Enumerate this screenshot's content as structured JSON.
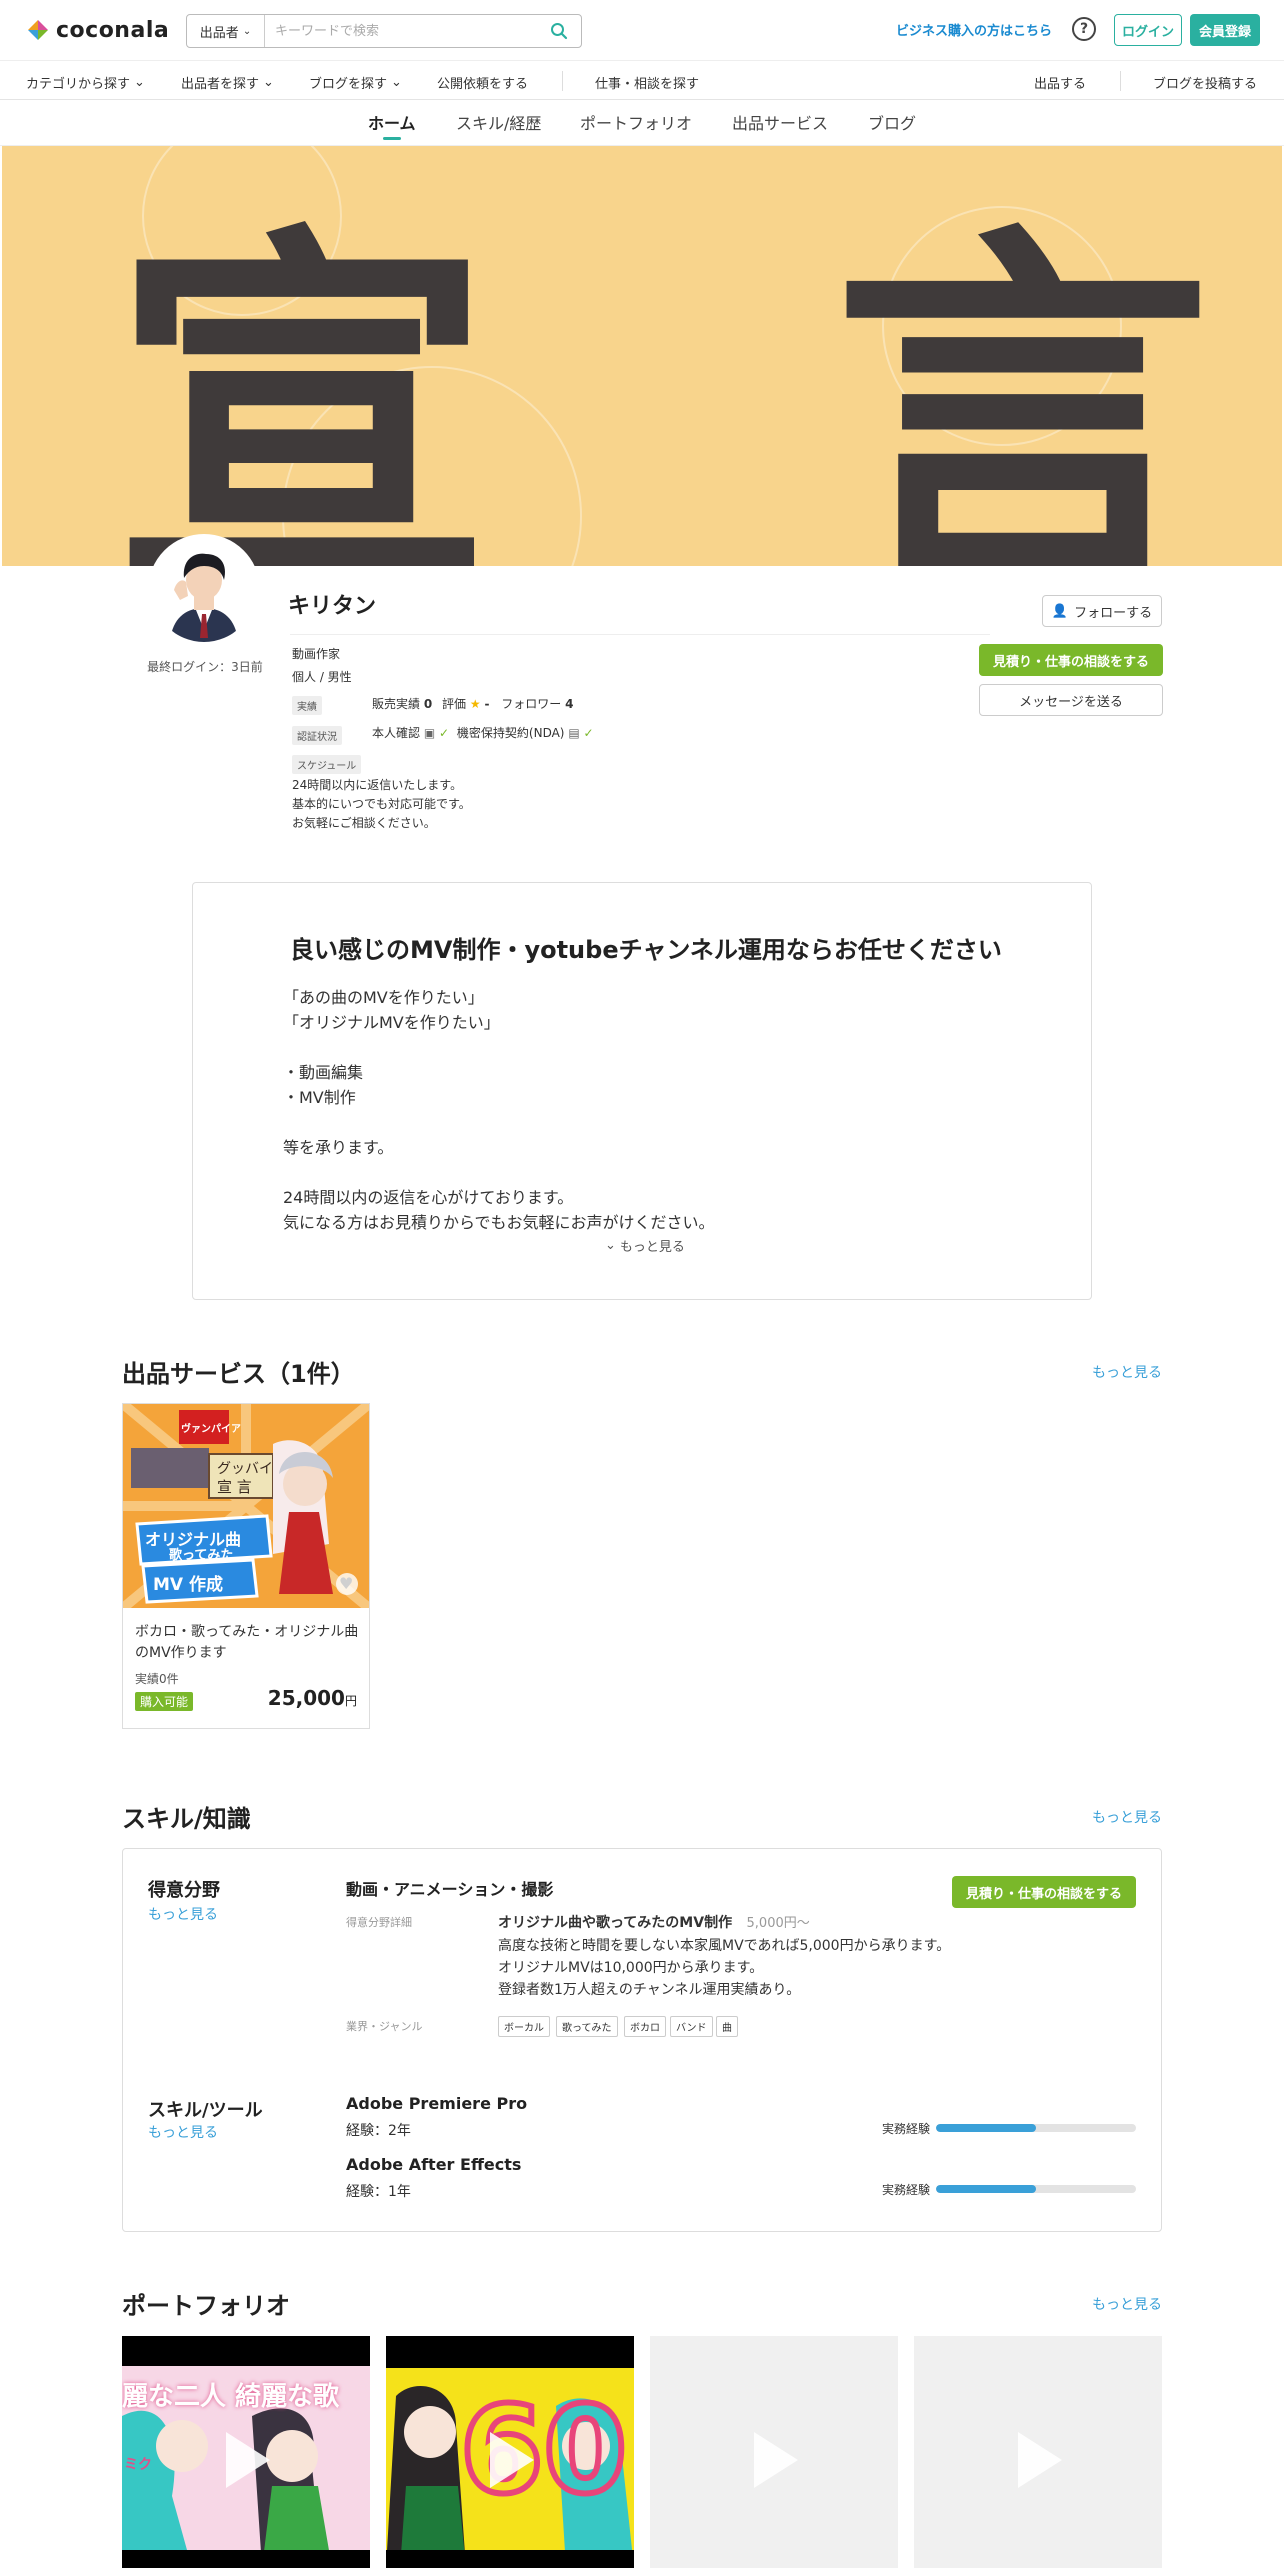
{
  "header": {
    "logo": "coconala",
    "search_select": "出品者",
    "search_placeholder": "キーワードで検索",
    "business_link": "ビジネス購入の方はこちら",
    "help": "?",
    "login": "ログイン",
    "signup": "会員登録"
  },
  "nav": {
    "items": [
      "カテゴリから探す",
      "出品者を探す",
      "ブログを探す",
      "公開依頼をする",
      "仕事・相談を探す",
      "出品する",
      "ブログを投稿する"
    ]
  },
  "profile_tabs": [
    "ホーム",
    "スキル/経歴",
    "ポートフォリオ",
    "出品サービス",
    "ブログ"
  ],
  "banner": {
    "text_left": "宣",
    "text_right": "言"
  },
  "profile": {
    "name": "キリタン",
    "last_login": "最終ログイン：3日前",
    "occupation": "動画作家",
    "type": "個人 / 男性",
    "tag_record": "実績",
    "sales_label": "販売実績",
    "sales_value": "0",
    "rating_label": "評価",
    "rating_value": "-",
    "follower_label": "フォロワー",
    "follower_value": "4",
    "tag_verify": "認証状況",
    "verify_id": "本人確認",
    "verify_nda": "機密保持契約(NDA)",
    "tag_schedule": "スケジュール",
    "schedule_lines": [
      "24時間以内に返信いたします。",
      "基本的にいつでも対応可能です。",
      "お気軽にご相談ください。"
    ],
    "follow_btn": "フォローする",
    "consult_btn": "見積り・仕事の相談をする",
    "message_btn": "メッセージを送る"
  },
  "intro": {
    "title": "良い感じのMV制作・yotubeチャンネル運用ならお任せください",
    "lines": [
      "「あの曲のMVを作りたい」",
      "「オリジナルMVを作りたい」",
      "",
      "・動画編集",
      "・MV制作",
      "",
      "等を承ります。",
      "",
      "24時間以内の返信を心がけております。",
      "気になる方はお見積りからでもお気軽にお声がけください。"
    ],
    "more": "もっと見る"
  },
  "services": {
    "title": "出品サービス（1件）",
    "more": "もっと見る",
    "items": [
      {
        "title": "ボカロ・歌ってみた・オリジナル曲のMV作ります",
        "sales_label": "実績",
        "sales_value": "0件",
        "badge": "購入可能",
        "price": "25,000",
        "price_unit": "円",
        "thumb_texts": [
          "ヴァンパイア",
          "グッバイ",
          "宣 言",
          "オリジナル曲",
          "歌ってみた",
          "MV 作成"
        ]
      }
    ]
  },
  "skills": {
    "title": "スキル/知識",
    "more": "もっと見る",
    "specialty_label": "得意分野",
    "specialty_more": "もっと見る",
    "category": "動画・アニメーション・撮影",
    "detail_label": "得意分野詳細",
    "detail_title": "オリジナル曲や歌ってみたのMV制作",
    "detail_price": "5,000円〜",
    "detail_lines": [
      "高度な技術と時間を要しない本家風MVであれば5,000円から承ります。",
      "オリジナルMVは10,000円から承ります。",
      "登録者数1万人超えのチャンネル運用実績あり。"
    ],
    "genre_label": "業界・ジャンル",
    "genres": [
      "ボーカル",
      "歌ってみた",
      "ボカロ",
      "バンド",
      "曲"
    ],
    "consult_btn": "見積り・仕事の相談をする",
    "tools_label": "スキル/ツール",
    "tools_more": "もっと見る",
    "tools": [
      {
        "name": "Adobe Premiere Pro",
        "exp": "経験：2年",
        "bar_label": "実務経験",
        "level": 0.5
      },
      {
        "name": "Adobe After Effects",
        "exp": "経験：1年",
        "bar_label": "実務経験",
        "level": 0.5
      }
    ]
  },
  "portfolio": {
    "title": "ポートフォリオ",
    "more": "もっと見る",
    "thumb1_text": "麗な二人 綺麗な歌",
    "thumb1_sub": "ミク",
    "thumb2_text": "60"
  },
  "colors": {
    "accent": "#2ab0a0",
    "green": "#7ab82a",
    "link": "#3aa0d8",
    "banner": "#f8d48c"
  }
}
